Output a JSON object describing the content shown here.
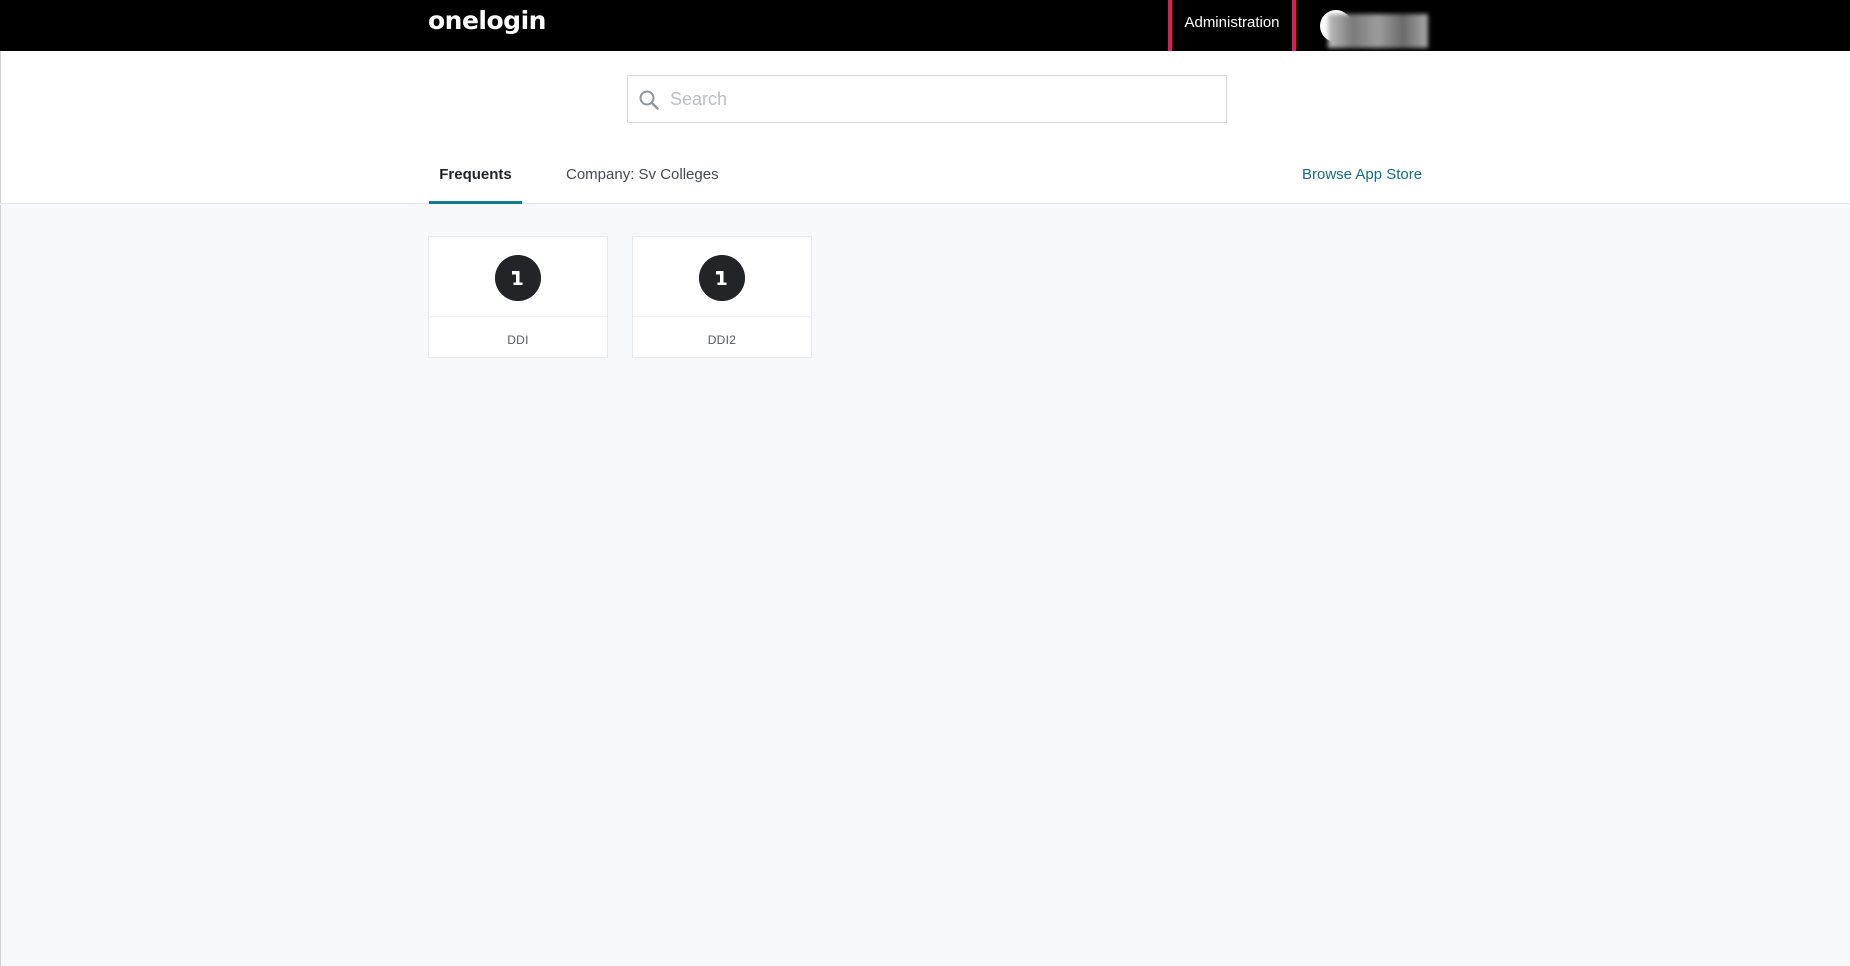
{
  "topbar": {
    "logo_text": "onelogin",
    "admin_label": "Administration"
  },
  "search": {
    "placeholder": "Search",
    "value": ""
  },
  "tabs": [
    {
      "label": "Frequents",
      "active": true
    },
    {
      "label": "Company: Sv Colleges",
      "active": false
    }
  ],
  "browse_link": "Browse App Store",
  "apps": [
    {
      "name": "DDI",
      "icon": "onelogin-app-icon"
    },
    {
      "name": "DDI2",
      "icon": "onelogin-app-icon"
    }
  ],
  "colors": {
    "topbar_bg": "#000000",
    "highlight_border": "#e8175d",
    "tab_underline": "#0f7d8c",
    "link": "#0f6f86",
    "app_icon_bg": "#222428"
  }
}
